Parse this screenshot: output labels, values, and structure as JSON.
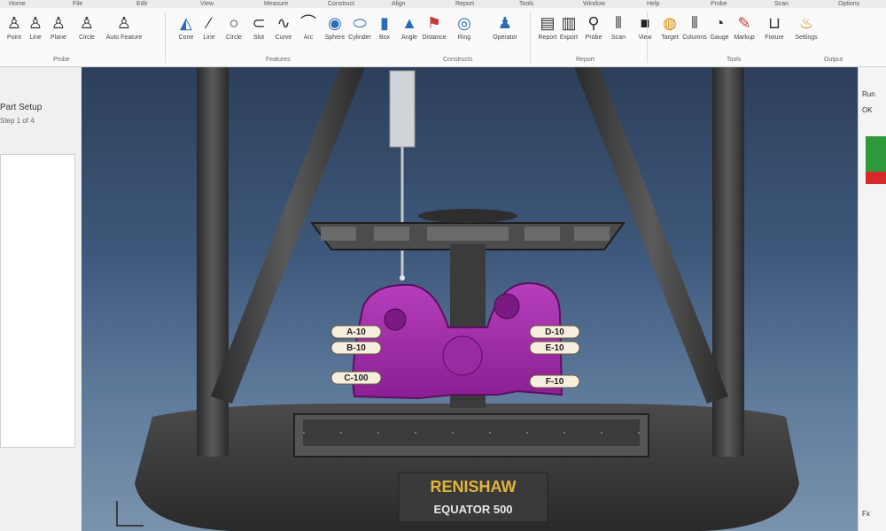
{
  "menu": {
    "items": [
      "Home",
      "File",
      "Edit",
      "View",
      "Measure",
      "Construct",
      "Align",
      "Report",
      "Tools",
      "Window",
      "Help",
      "Probe",
      "Scan",
      "Options"
    ]
  },
  "ribbon": {
    "buttons": [
      {
        "icon": "stick-figure-icon",
        "glyph": "♙",
        "label": "Point"
      },
      {
        "icon": "stick-figure-icon",
        "glyph": "♙",
        "label": "Line"
      },
      {
        "icon": "stick-figure-icon",
        "glyph": "♙",
        "label": "Plane"
      },
      {
        "icon": "stick-figure-icon",
        "glyph": "♙",
        "label": "Circle"
      },
      {
        "icon": "stick-figure-icon",
        "glyph": "♙",
        "label": "Auto Feature"
      },
      {
        "icon": "cone-icon",
        "glyph": "◭",
        "label": "Cone"
      },
      {
        "icon": "line-icon",
        "glyph": "∕",
        "label": "Line"
      },
      {
        "icon": "circle-icon",
        "glyph": "○",
        "label": "Circle"
      },
      {
        "icon": "slot-icon",
        "glyph": "⊂",
        "label": "Slot"
      },
      {
        "icon": "curve-icon",
        "glyph": "∿",
        "label": "Curve"
      },
      {
        "icon": "arc-icon",
        "glyph": "⌒",
        "label": "Arc"
      },
      {
        "icon": "sphere-icon",
        "glyph": "◉",
        "label": "Sphere"
      },
      {
        "icon": "cylinder-icon",
        "glyph": "⬭",
        "label": "Cylinder"
      },
      {
        "icon": "box-icon",
        "glyph": "▮",
        "label": "Box"
      },
      {
        "icon": "triangle-icon",
        "glyph": "▲",
        "label": "Angle"
      },
      {
        "icon": "flag-icon",
        "glyph": "⚑",
        "label": "Distance"
      },
      {
        "icon": "ring-icon",
        "glyph": "◎",
        "label": "Ring"
      },
      {
        "icon": "person-icon",
        "glyph": "♟",
        "label": "Operator"
      },
      {
        "icon": "doc-icon",
        "glyph": "▤",
        "label": "Report"
      },
      {
        "icon": "doc2-icon",
        "glyph": "▥",
        "label": "Export"
      },
      {
        "icon": "probe-icon",
        "glyph": "⚲",
        "label": "Probe"
      },
      {
        "icon": "bars-icon",
        "glyph": "⦀",
        "label": "Scan"
      },
      {
        "icon": "screen-icon",
        "glyph": "■",
        "label": "View"
      },
      {
        "icon": "target-icon",
        "glyph": "◍",
        "label": "Target"
      },
      {
        "icon": "columns-icon",
        "glyph": "⦀",
        "label": "Columns"
      },
      {
        "icon": "gauge-icon",
        "glyph": "◔",
        "label": "Gauge"
      },
      {
        "icon": "pen-icon",
        "glyph": "✎",
        "label": "Markup"
      },
      {
        "icon": "cup-icon",
        "glyph": "⊔",
        "label": "Fixture"
      },
      {
        "icon": "bulb-icon",
        "glyph": "♨",
        "label": "Settings"
      }
    ],
    "group_labels": [
      "Probe",
      "Features",
      "Constructs",
      "Report",
      "Tools",
      "Output"
    ]
  },
  "left_panel": {
    "header": "Part Setup",
    "sub": "Step 1 of 4"
  },
  "viewport": {
    "machine_brand": "RENISHAW",
    "machine_model": "EQUATOR 500",
    "labels": [
      {
        "text": "A-10",
        "side": "left"
      },
      {
        "text": "B-10",
        "side": "left"
      },
      {
        "text": "C-100",
        "side": "left"
      },
      {
        "text": "D-10",
        "side": "right"
      },
      {
        "text": "E-10",
        "side": "right"
      },
      {
        "text": "F-10",
        "side": "right"
      }
    ]
  },
  "right_panel": {
    "top_label": "Run",
    "status_label": "OK",
    "bottom_label": "Fx"
  },
  "colors": {
    "part": "#a12ca8",
    "frame": "#3a3a3a",
    "viewport_top": "#2d3f5a",
    "viewport_bottom": "#7a93ad",
    "status_ok": "#2e9a3c",
    "status_fail": "#d62a2a",
    "brand_plate": "#e0b53a"
  }
}
